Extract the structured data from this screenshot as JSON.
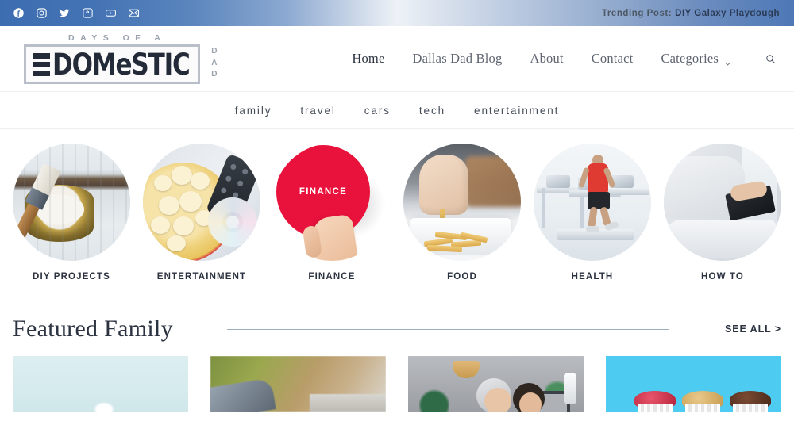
{
  "topbar": {
    "social": [
      {
        "name": "facebook-icon",
        "label": "Facebook"
      },
      {
        "name": "instagram-icon",
        "label": "Instagram"
      },
      {
        "name": "twitter-icon",
        "label": "Twitter"
      },
      {
        "name": "pinterest-icon",
        "label": "Pinterest"
      },
      {
        "name": "youtube-icon",
        "label": "YouTube"
      },
      {
        "name": "email-icon",
        "label": "Email"
      }
    ],
    "trending_label": "Trending Post:",
    "trending_link": "DIY Galaxy Playdough"
  },
  "logo": {
    "tagline": "DAYS OF A",
    "name": "DOMeSTIC",
    "suffix_letters": [
      "D",
      "A",
      "D"
    ]
  },
  "nav": {
    "items": [
      {
        "label": "Home",
        "active": true
      },
      {
        "label": "Dallas Dad Blog",
        "active": false
      },
      {
        "label": "About",
        "active": false
      },
      {
        "label": "Contact",
        "active": false
      }
    ],
    "categories_label": "Categories",
    "search_label": "Search"
  },
  "subnav": {
    "items": [
      "family",
      "travel",
      "cars",
      "tech",
      "entertainment"
    ]
  },
  "categories": [
    {
      "label": "DIY PROJECTS",
      "art": "diy"
    },
    {
      "label": "ENTERTAINMENT",
      "art": "ent"
    },
    {
      "label": "FINANCE",
      "art": "fin",
      "badge": "FINANCE"
    },
    {
      "label": "FOOD",
      "art": "food"
    },
    {
      "label": "HEALTH",
      "art": "hea"
    },
    {
      "label": "HOW TO",
      "art": "how"
    }
  ],
  "featured": {
    "title": "Featured Family",
    "see_all": "SEE ALL >"
  },
  "cards": [
    {
      "name": "card-1"
    },
    {
      "name": "card-2"
    },
    {
      "name": "card-3"
    },
    {
      "name": "card-4"
    }
  ],
  "colors": {
    "topbar_blue": "#3d6db1",
    "finance_red": "#e8123c",
    "card4_cyan": "#4ecbf0",
    "text_dark": "#2b3240",
    "rule": "#9fb0bd"
  }
}
